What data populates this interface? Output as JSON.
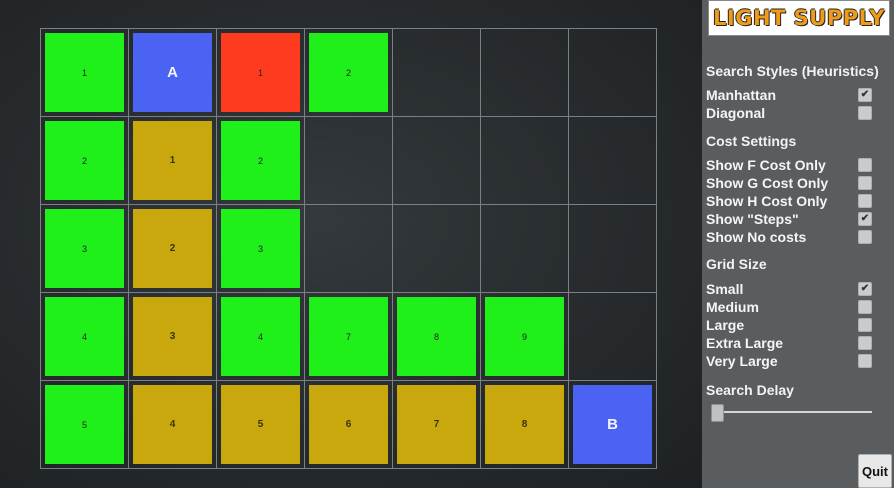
{
  "logo": "LIGHT SUPPLY",
  "sections": {
    "heuristics_title": "Search Styles (Heuristics)",
    "cost_title": "Cost Settings",
    "grid_title": "Grid Size",
    "delay_title": "Search Delay"
  },
  "heuristics": [
    {
      "label": "Manhattan",
      "checked": true
    },
    {
      "label": "Diagonal",
      "checked": false
    }
  ],
  "cost_settings": [
    {
      "label": "Show F Cost Only",
      "checked": false
    },
    {
      "label": "Show G Cost Only",
      "checked": false
    },
    {
      "label": "Show H Cost Only",
      "checked": false
    },
    {
      "label": "Show \"Steps\"",
      "checked": true
    },
    {
      "label": "Show No costs",
      "checked": false
    }
  ],
  "grid_sizes": [
    {
      "label": "Small",
      "checked": true
    },
    {
      "label": "Medium",
      "checked": false
    },
    {
      "label": "Large",
      "checked": false
    },
    {
      "label": "Extra Large",
      "checked": false
    },
    {
      "label": "Very Large",
      "checked": false
    }
  ],
  "search_delay": 0,
  "quit_label": "Quit",
  "colors": {
    "open": "#1ff01a",
    "path": "#c9a80e",
    "blocked": "#ff3b1f",
    "endpoint": "#4b63f2"
  },
  "grid": {
    "rows": 5,
    "cols": 7,
    "cells": [
      [
        {
          "type": "open",
          "label": "1"
        },
        {
          "type": "endpoint",
          "label": "A"
        },
        {
          "type": "blocked",
          "label": "1"
        },
        {
          "type": "open",
          "label": "2"
        },
        {
          "type": "empty",
          "label": ""
        },
        {
          "type": "empty",
          "label": ""
        },
        {
          "type": "empty",
          "label": ""
        }
      ],
      [
        {
          "type": "open",
          "label": "2"
        },
        {
          "type": "path",
          "label": "1"
        },
        {
          "type": "open",
          "label": "2"
        },
        {
          "type": "empty",
          "label": ""
        },
        {
          "type": "empty",
          "label": ""
        },
        {
          "type": "empty",
          "label": ""
        },
        {
          "type": "empty",
          "label": ""
        }
      ],
      [
        {
          "type": "open",
          "label": "3"
        },
        {
          "type": "path",
          "label": "2"
        },
        {
          "type": "open",
          "label": "3"
        },
        {
          "type": "empty",
          "label": ""
        },
        {
          "type": "empty",
          "label": ""
        },
        {
          "type": "empty",
          "label": ""
        },
        {
          "type": "empty",
          "label": ""
        }
      ],
      [
        {
          "type": "open",
          "label": "4"
        },
        {
          "type": "path",
          "label": "3"
        },
        {
          "type": "open",
          "label": "4"
        },
        {
          "type": "open",
          "label": "7"
        },
        {
          "type": "open",
          "label": "8"
        },
        {
          "type": "open",
          "label": "9"
        },
        {
          "type": "empty",
          "label": ""
        }
      ],
      [
        {
          "type": "open",
          "label": "5"
        },
        {
          "type": "path",
          "label": "4"
        },
        {
          "type": "path",
          "label": "5"
        },
        {
          "type": "path",
          "label": "6"
        },
        {
          "type": "path",
          "label": "7"
        },
        {
          "type": "path",
          "label": "8"
        },
        {
          "type": "endpoint",
          "label": "B"
        }
      ]
    ]
  }
}
